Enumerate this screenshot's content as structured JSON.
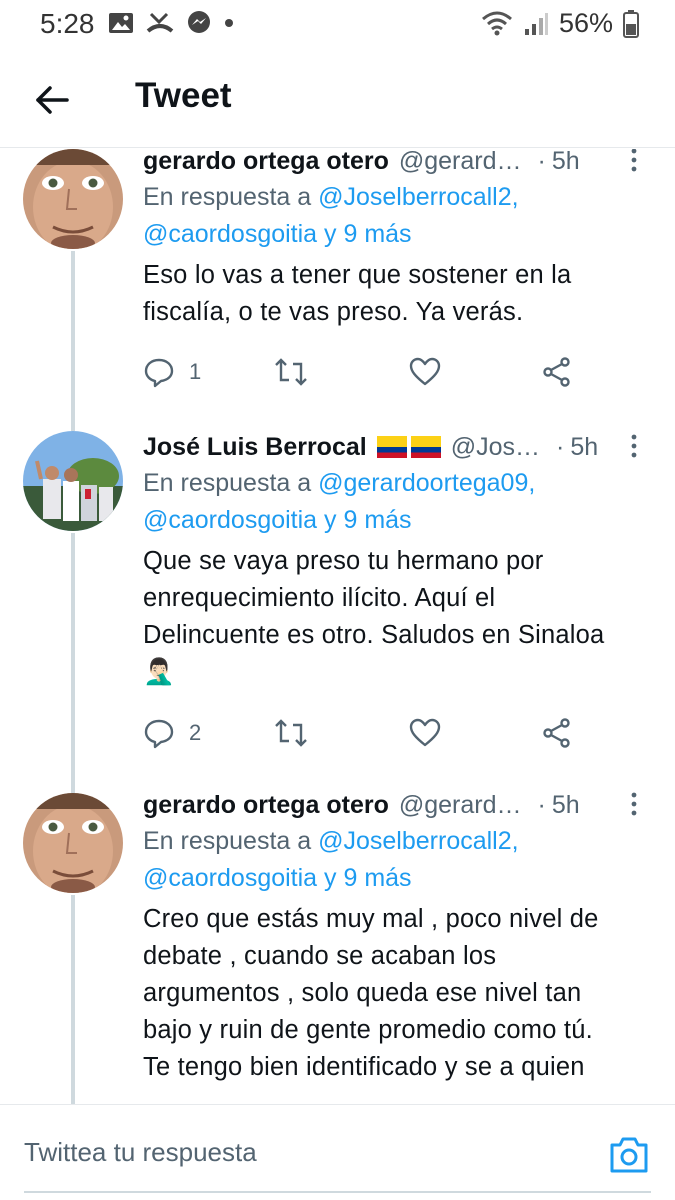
{
  "status_bar": {
    "time": "5:28",
    "battery": "56%",
    "icons": [
      "image-icon",
      "missed-call-icon",
      "messenger-icon",
      "dot-icon",
      "wifi-icon",
      "signal-icon",
      "battery-icon"
    ]
  },
  "header": {
    "title": "Tweet"
  },
  "tweets": [
    {
      "display_name": "gerardo ortega otero",
      "handle": "@gerard…",
      "dot": "·",
      "time": "5h",
      "reply_prefix": "En respuesta a ",
      "reply_mention_1": "@Joselberrocall2,",
      "reply_mention_2": "@caordosgoitia y 9 más",
      "text_lines": [
        "Eso lo vas a tener que sostener en la",
        "fiscalía, o te vas preso. Ya verás."
      ],
      "reply_count": "1"
    },
    {
      "display_name": "José Luis Berrocal",
      "flags": "🇨🇴🇨🇴",
      "handle": "@Jos…",
      "dot": "·",
      "time": "5h",
      "reply_prefix": "En respuesta a ",
      "reply_mention_1": "@gerardoortega09,",
      "reply_mention_2": "@caordosgoitia y 9 más",
      "text_lines": [
        "Que se vaya preso tu hermano por",
        "enrequecimiento ilícito. Aquí el",
        "Delincuente es otro. Saludos en Sinaloa",
        "🤦🏻‍♂️"
      ],
      "reply_count": "2"
    },
    {
      "display_name": "gerardo ortega otero",
      "handle": "@gerard…",
      "dot": "·",
      "time": "5h",
      "reply_prefix": "En respuesta a ",
      "reply_mention_1": "@Joselberrocall2,",
      "reply_mention_2": "@caordosgoitia y 9 más",
      "text_lines": [
        "Creo que estás muy mal , poco nivel de",
        "debate , cuando se acaban los",
        "argumentos , solo queda ese nivel tan",
        "bajo y ruin de gente promedio como tú.",
        "Te tengo bien identificado y se a quien"
      ]
    }
  ],
  "composer": {
    "placeholder": "Twittea tu respuesta"
  },
  "colors": {
    "accent": "#1d9bf0",
    "text": "#0f1419",
    "secondary": "#536471",
    "thread_line": "#cfd9de"
  }
}
